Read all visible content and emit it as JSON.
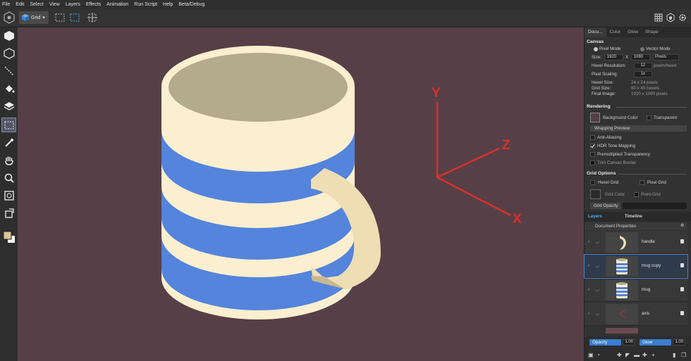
{
  "menu": [
    "File",
    "Edit",
    "Select",
    "View",
    "Layers",
    "Effects",
    "Animation",
    "Run Script",
    "Help",
    "Beta/Debug"
  ],
  "toolbar": {
    "mode_label": "Grid"
  },
  "panel": {
    "tabs": [
      "Docu...",
      "Color",
      "Glow",
      "Shape"
    ],
    "canvas": {
      "title": "Canvas",
      "pixel_mode": "Pixel Mode",
      "vector_mode": "Vector Mode",
      "size_label": "Size:",
      "width": "1920",
      "x_sep": "X",
      "height": "1080",
      "unit": "Pixels",
      "hexel_res_label": "Hexel Resolution:",
      "hexel_res": "12",
      "hexel_res_unit": "pixels/hexel",
      "pixel_scaling_label": "Pixel Scaling:",
      "pixel_scaling": "1x",
      "hexel_size_label": "Hexel Size:",
      "hexel_size": "24 x 24 pixels",
      "grid_size_label": "Grid Size:",
      "grid_size": "80 x 45 hexels",
      "final_image_label": "Final Image:",
      "final_image": "1920 x 1080 pixels"
    },
    "rendering": {
      "title": "Rendering",
      "bg_color": "Background Color",
      "transparent": "Transparent",
      "wrapping": "Wrapping Preview",
      "anti_aliasing": "Anti-Aliasing",
      "hdr": "HDR Tone Mapping",
      "premult": "Premultiplied Transparency",
      "trim": "Trim Canvas Border"
    },
    "grid_options": {
      "title": "Grid Options",
      "hexel_grid": "Hexel Grid",
      "pixel_grid": "Pixel Grid",
      "grid_color": "Grid Color",
      "point_grid": "Point-Grid",
      "grid_opacity": "Grid Opacity"
    },
    "layers_tabs": [
      "Layers",
      "Timeline"
    ],
    "doc_props": "Document Properties",
    "layers": [
      "handle",
      "mug copy",
      "mug",
      "axis"
    ],
    "opacity_label": "Opacity",
    "opacity_value": "1.00",
    "glow_label": "Glow",
    "glow_value": "1.00"
  },
  "canvas_axes": {
    "y": "Y",
    "z": "Z",
    "x": "X"
  },
  "colors": {
    "background": "#573f47",
    "cream": "#fbefcf",
    "stripe": "#5484dc",
    "handle": "#efddb4",
    "axis": "#d8312b",
    "accent": "#4a8de0"
  }
}
